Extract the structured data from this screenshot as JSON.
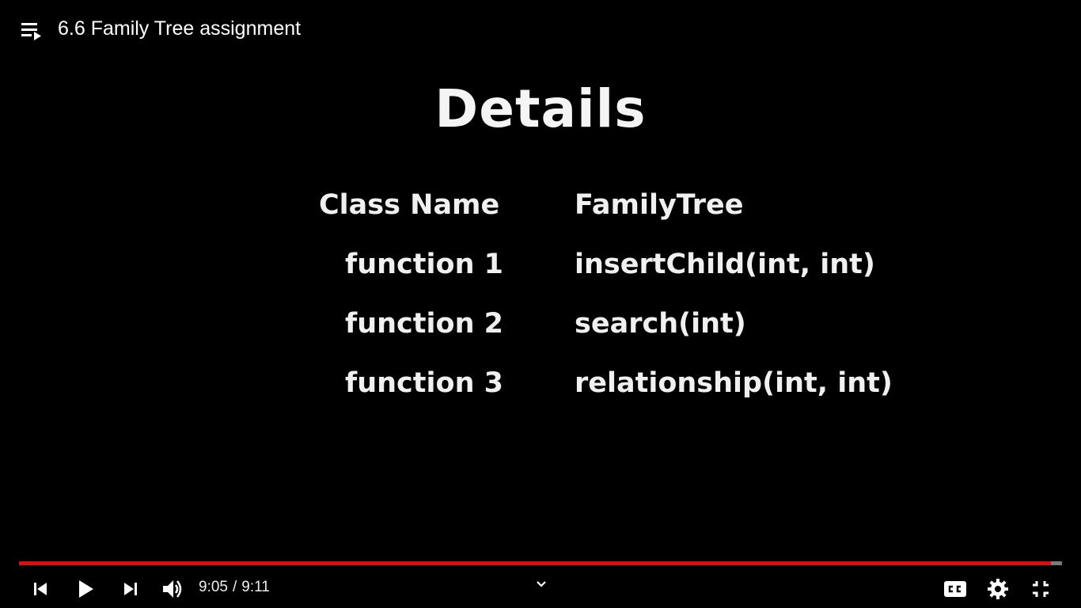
{
  "video": {
    "title": "6.6 Family Tree assignment"
  },
  "slide": {
    "heading": "Details",
    "rows": [
      {
        "label": "Class Name",
        "value": "FamilyTree"
      },
      {
        "label": "function 1",
        "value": "insertChild(int, int)"
      },
      {
        "label": "function 2",
        "value": "search(int)"
      },
      {
        "label": "function 3",
        "value": "relationship(int, int)"
      }
    ]
  },
  "player": {
    "current_time": "9:05",
    "separator": "/",
    "duration": "9:11",
    "progress_fraction": 0.989,
    "progress_color": "#ff0000",
    "controls": {
      "previous": "skip-previous-icon",
      "play": "play-icon",
      "next": "skip-next-icon",
      "volume": "volume-icon",
      "more": "chevron-down-icon",
      "captions": "closed-captions-icon",
      "settings": "gear-icon",
      "fullscreen_exit": "exit-fullscreen-icon"
    }
  }
}
